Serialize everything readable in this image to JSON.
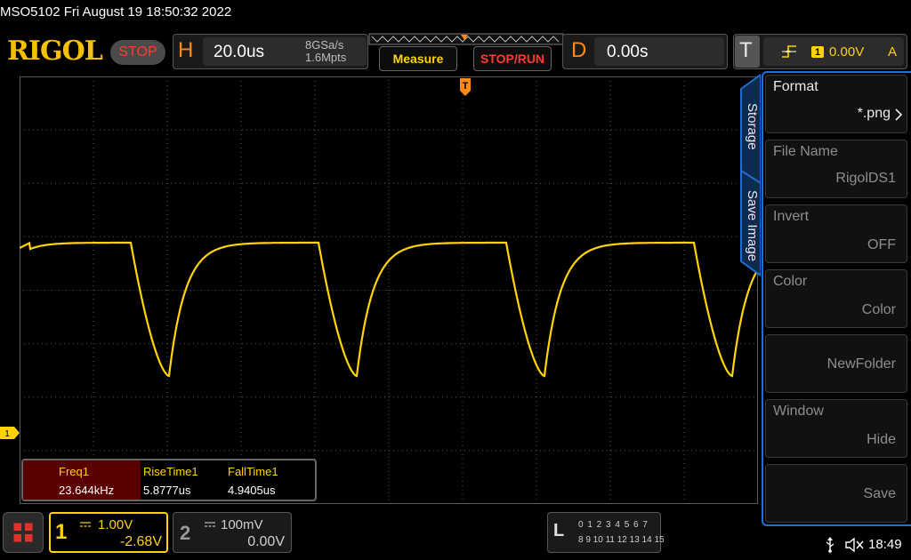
{
  "status_bar": {
    "text": "MSO5102  Fri August 19 18:50:32 2022"
  },
  "header": {
    "logo": "RIGOL",
    "run_state": "STOP",
    "horizontal": {
      "letter": "H",
      "timebase": "20.0us",
      "sample_rate": "8GSa/s",
      "memory_depth": "1.6Mpts"
    },
    "measure_label": "Measure",
    "stoprun_label": "STOP/RUN",
    "delay": {
      "letter": "D",
      "value": "0.00s"
    },
    "trigger": {
      "letter": "T",
      "source": "1",
      "level": "0.00V",
      "mode": "A"
    }
  },
  "colors": {
    "ch1": "#ffd400",
    "accent_orange": "#ff8a1a",
    "stop_red": "#ff3b2f",
    "panel_blue": "#1f6fd0",
    "grid": "#5a5a5a"
  },
  "measurements": {
    "headers": [
      "Freq1",
      "RiseTime1",
      "FallTime1"
    ],
    "values": [
      "23.644kHz",
      "5.8777us",
      "4.9405us"
    ]
  },
  "side_panel": {
    "tabs": [
      "Storage",
      "Save Image"
    ],
    "items": [
      {
        "title": "Format",
        "value": "*.png"
      },
      {
        "title": "File Name",
        "value": "RigolDS1"
      },
      {
        "title": "Invert",
        "value": "OFF"
      },
      {
        "title": "Color",
        "value": "Color"
      },
      {
        "title": "",
        "value": "NewFolder"
      },
      {
        "title": "Window",
        "value": "Hide"
      },
      {
        "title": "",
        "value": "Save"
      }
    ]
  },
  "channels": {
    "ch1": {
      "number": "1",
      "scale": "1.00V",
      "offset": "-2.68V"
    },
    "ch2": {
      "number": "2",
      "scale": "100mV",
      "offset": "0.00V"
    }
  },
  "logic": {
    "letter": "L",
    "row1": "0 1 2 3  4 5 6 7",
    "row2": "8 9 10 11 12 13 14 15"
  },
  "ch1_marker": "1",
  "clock": "18:49",
  "icons": [
    "home-icon",
    "usb-icon",
    "speaker-muted-icon",
    "trigger-rising-edge-icon",
    "trigger-position-icon"
  ]
}
